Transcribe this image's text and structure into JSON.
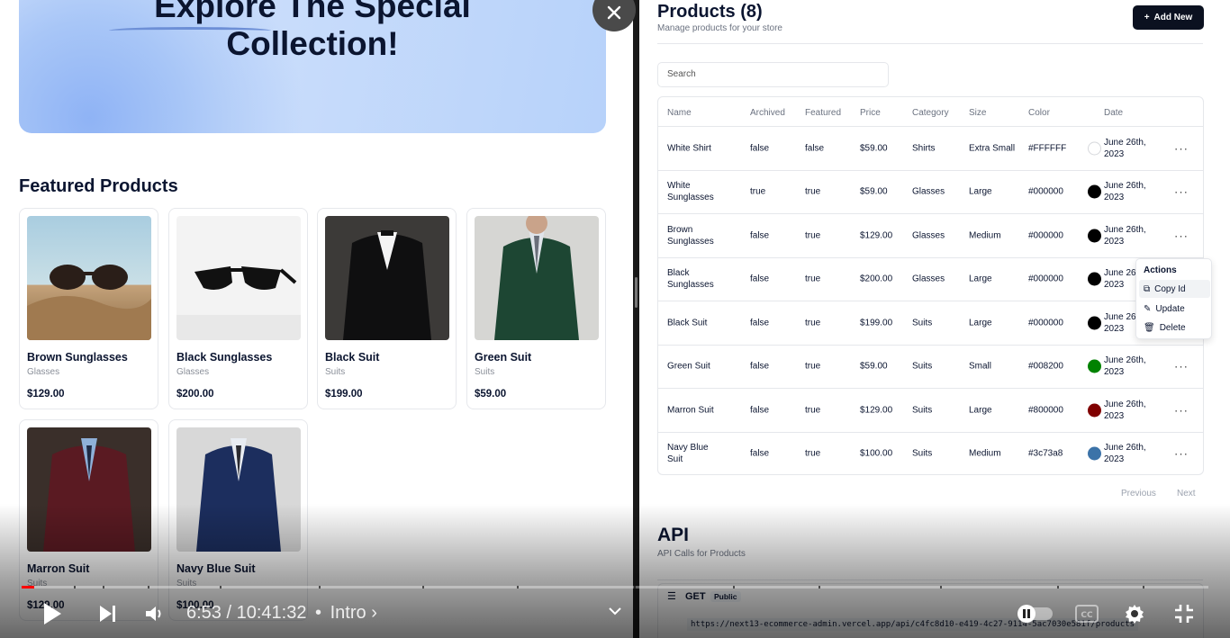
{
  "store": {
    "hero": {
      "line1": "Explore The Special",
      "line2": "Collection!"
    },
    "featured_title": "Featured Products",
    "products": [
      {
        "name": "Brown Sunglasses",
        "category": "Glasses",
        "price": "$129.00",
        "icon": "brown-sunglasses-image"
      },
      {
        "name": "Black Sunglasses",
        "category": "Glasses",
        "price": "$200.00",
        "icon": "black-sunglasses-image"
      },
      {
        "name": "Black Suit",
        "category": "Suits",
        "price": "$199.00",
        "icon": "black-suit-image"
      },
      {
        "name": "Green Suit",
        "category": "Suits",
        "price": "$59.00",
        "icon": "green-suit-image"
      },
      {
        "name": "Marron Suit",
        "category": "Suits",
        "price": "$129.00",
        "icon": "maroon-suit-image"
      },
      {
        "name": "Navy Blue Suit",
        "category": "Suits",
        "price": "$100.00",
        "icon": "navy-suit-image"
      }
    ]
  },
  "admin": {
    "title": "Products (8)",
    "subtitle": "Manage products for your store",
    "add_new": "Add New",
    "search_placeholder": "Search",
    "columns": [
      "Name",
      "Archived",
      "Featured",
      "Price",
      "Category",
      "Size",
      "Color",
      "Date"
    ],
    "rows": [
      {
        "name": "White Shirt",
        "archived": "false",
        "featured": "false",
        "price": "$59.00",
        "category": "Shirts",
        "size": "Extra Small",
        "color": "#FFFFFF",
        "date": "June 26th, 2023"
      },
      {
        "name": "White Sunglasses",
        "archived": "true",
        "featured": "true",
        "price": "$59.00",
        "category": "Glasses",
        "size": "Large",
        "color": "#000000",
        "date": "June 26th, 2023"
      },
      {
        "name": "Brown Sunglasses",
        "archived": "false",
        "featured": "true",
        "price": "$129.00",
        "category": "Glasses",
        "size": "Medium",
        "color": "#000000",
        "date": "June 26th, 2023"
      },
      {
        "name": "Black Sunglasses",
        "archived": "false",
        "featured": "true",
        "price": "$200.00",
        "category": "Glasses",
        "size": "Large",
        "color": "#000000",
        "date": "June 26th, 2023"
      },
      {
        "name": "Black Suit",
        "archived": "false",
        "featured": "true",
        "price": "$199.00",
        "category": "Suits",
        "size": "Large",
        "color": "#000000",
        "date": "June 26th, 2023"
      },
      {
        "name": "Green Suit",
        "archived": "false",
        "featured": "true",
        "price": "$59.00",
        "category": "Suits",
        "size": "Small",
        "color": "#008200",
        "date": "June 26th, 2023"
      },
      {
        "name": "Marron Suit",
        "archived": "false",
        "featured": "true",
        "price": "$129.00",
        "category": "Suits",
        "size": "Large",
        "color": "#800000",
        "date": "June 26th, 2023"
      },
      {
        "name": "Navy Blue Suit",
        "archived": "false",
        "featured": "true",
        "price": "$100.00",
        "category": "Suits",
        "size": "Medium",
        "color": "#3c73a8",
        "date": "June 26th, 2023"
      }
    ],
    "menu": {
      "title": "Actions",
      "items": [
        "Copy Id",
        "Update",
        "Delete"
      ]
    },
    "pagination": {
      "previous": "Previous",
      "next": "Next"
    },
    "api": {
      "title": "API",
      "subtitle": "API Calls for Products",
      "method": "GET",
      "badge": "Public",
      "url": "https://next13-ecommerce-admin.vercel.app/api/c4fc8d10-e419-4c27-9114-5ac7030e581f/products"
    }
  },
  "player": {
    "current_time": "6:53",
    "duration": "10:41:32",
    "chapter": "Intro",
    "progress": 0.011,
    "accent": "#ff0000"
  }
}
